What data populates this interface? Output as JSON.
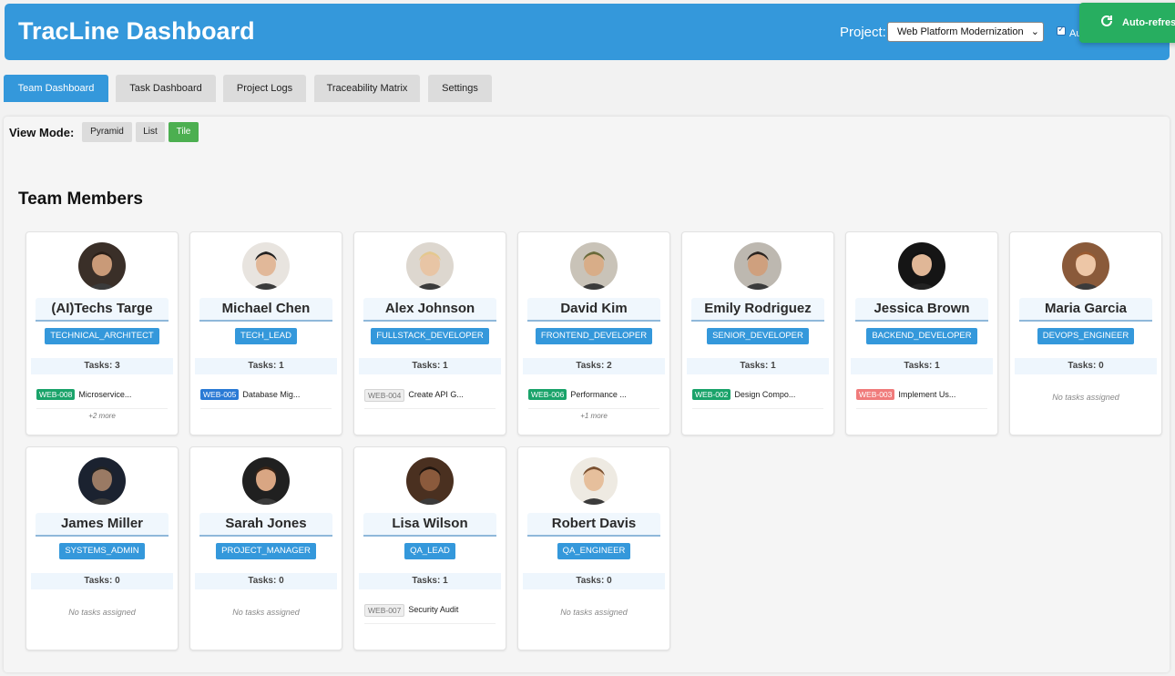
{
  "header": {
    "title": "TracLine Dashboard",
    "project_label": "Project:",
    "project_value": "Web Platform Modernization",
    "auto_refresh_checked": true,
    "auto_refresh_label": "Au"
  },
  "toast": {
    "text": "Auto-refres",
    "icon": "refresh-icon",
    "color": "#27ae60"
  },
  "tabs": [
    {
      "label": "Team Dashboard",
      "active": true
    },
    {
      "label": "Task Dashboard",
      "active": false
    },
    {
      "label": "Project Logs",
      "active": false
    },
    {
      "label": "Traceability Matrix",
      "active": false
    },
    {
      "label": "Settings",
      "active": false
    }
  ],
  "view_mode": {
    "label": "View Mode:",
    "options": [
      {
        "label": "Pyramid",
        "active": false
      },
      {
        "label": "List",
        "active": false
      },
      {
        "label": "Tile",
        "active": true
      }
    ]
  },
  "section_title": "Team Members",
  "colors": {
    "header": "#3498db",
    "role_badge": "#3498db",
    "tile_active": "#4caf50",
    "status_green": "#1aa36a",
    "status_blue": "#2a7ad5",
    "status_gray": "#eeeeee",
    "status_red": "#f07b7b"
  },
  "members": [
    {
      "name": "(AI)Techs Targe",
      "role": "TECHNICAL_ARCHITECT",
      "tasks_label": "Tasks: 3",
      "tasks": [
        {
          "id": "WEB-008",
          "title": "Microservice...",
          "status": "green"
        }
      ],
      "more": "+2 more",
      "empty": ""
    },
    {
      "name": "Michael Chen",
      "role": "TECH_LEAD",
      "tasks_label": "Tasks: 1",
      "tasks": [
        {
          "id": "WEB-005",
          "title": "Database Mig...",
          "status": "blue"
        }
      ],
      "more": "",
      "empty": ""
    },
    {
      "name": "Alex Johnson",
      "role": "FULLSTACK_DEVELOPER",
      "tasks_label": "Tasks: 1",
      "tasks": [
        {
          "id": "WEB-004",
          "title": "Create API G...",
          "status": "gray"
        }
      ],
      "more": "",
      "empty": ""
    },
    {
      "name": "David Kim",
      "role": "FRONTEND_DEVELOPER",
      "tasks_label": "Tasks: 2",
      "tasks": [
        {
          "id": "WEB-006",
          "title": "Performance ...",
          "status": "green"
        }
      ],
      "more": "+1 more",
      "empty": ""
    },
    {
      "name": "Emily Rodriguez",
      "role": "SENIOR_DEVELOPER",
      "tasks_label": "Tasks: 1",
      "tasks": [
        {
          "id": "WEB-002",
          "title": "Design Compo...",
          "status": "green"
        }
      ],
      "more": "",
      "empty": ""
    },
    {
      "name": "Jessica Brown",
      "role": "BACKEND_DEVELOPER",
      "tasks_label": "Tasks: 1",
      "tasks": [
        {
          "id": "WEB-003",
          "title": "Implement Us...",
          "status": "red"
        }
      ],
      "more": "",
      "empty": ""
    },
    {
      "name": "Maria Garcia",
      "role": "DEVOPS_ENGINEER",
      "tasks_label": "Tasks: 0",
      "tasks": [],
      "more": "",
      "empty": "No tasks assigned"
    },
    {
      "name": "James Miller",
      "role": "SYSTEMS_ADMIN",
      "tasks_label": "Tasks: 0",
      "tasks": [],
      "more": "",
      "empty": "No tasks assigned"
    },
    {
      "name": "Sarah Jones",
      "role": "PROJECT_MANAGER",
      "tasks_label": "Tasks: 0",
      "tasks": [],
      "more": "",
      "empty": "No tasks assigned"
    },
    {
      "name": "Lisa Wilson",
      "role": "QA_LEAD",
      "tasks_label": "Tasks: 1",
      "tasks": [
        {
          "id": "WEB-007",
          "title": "Security Audit",
          "status": "gray"
        }
      ],
      "more": "",
      "empty": ""
    },
    {
      "name": "Robert Davis",
      "role": "QA_ENGINEER",
      "tasks_label": "Tasks: 0",
      "tasks": [],
      "more": "",
      "empty": "No tasks assigned"
    }
  ]
}
